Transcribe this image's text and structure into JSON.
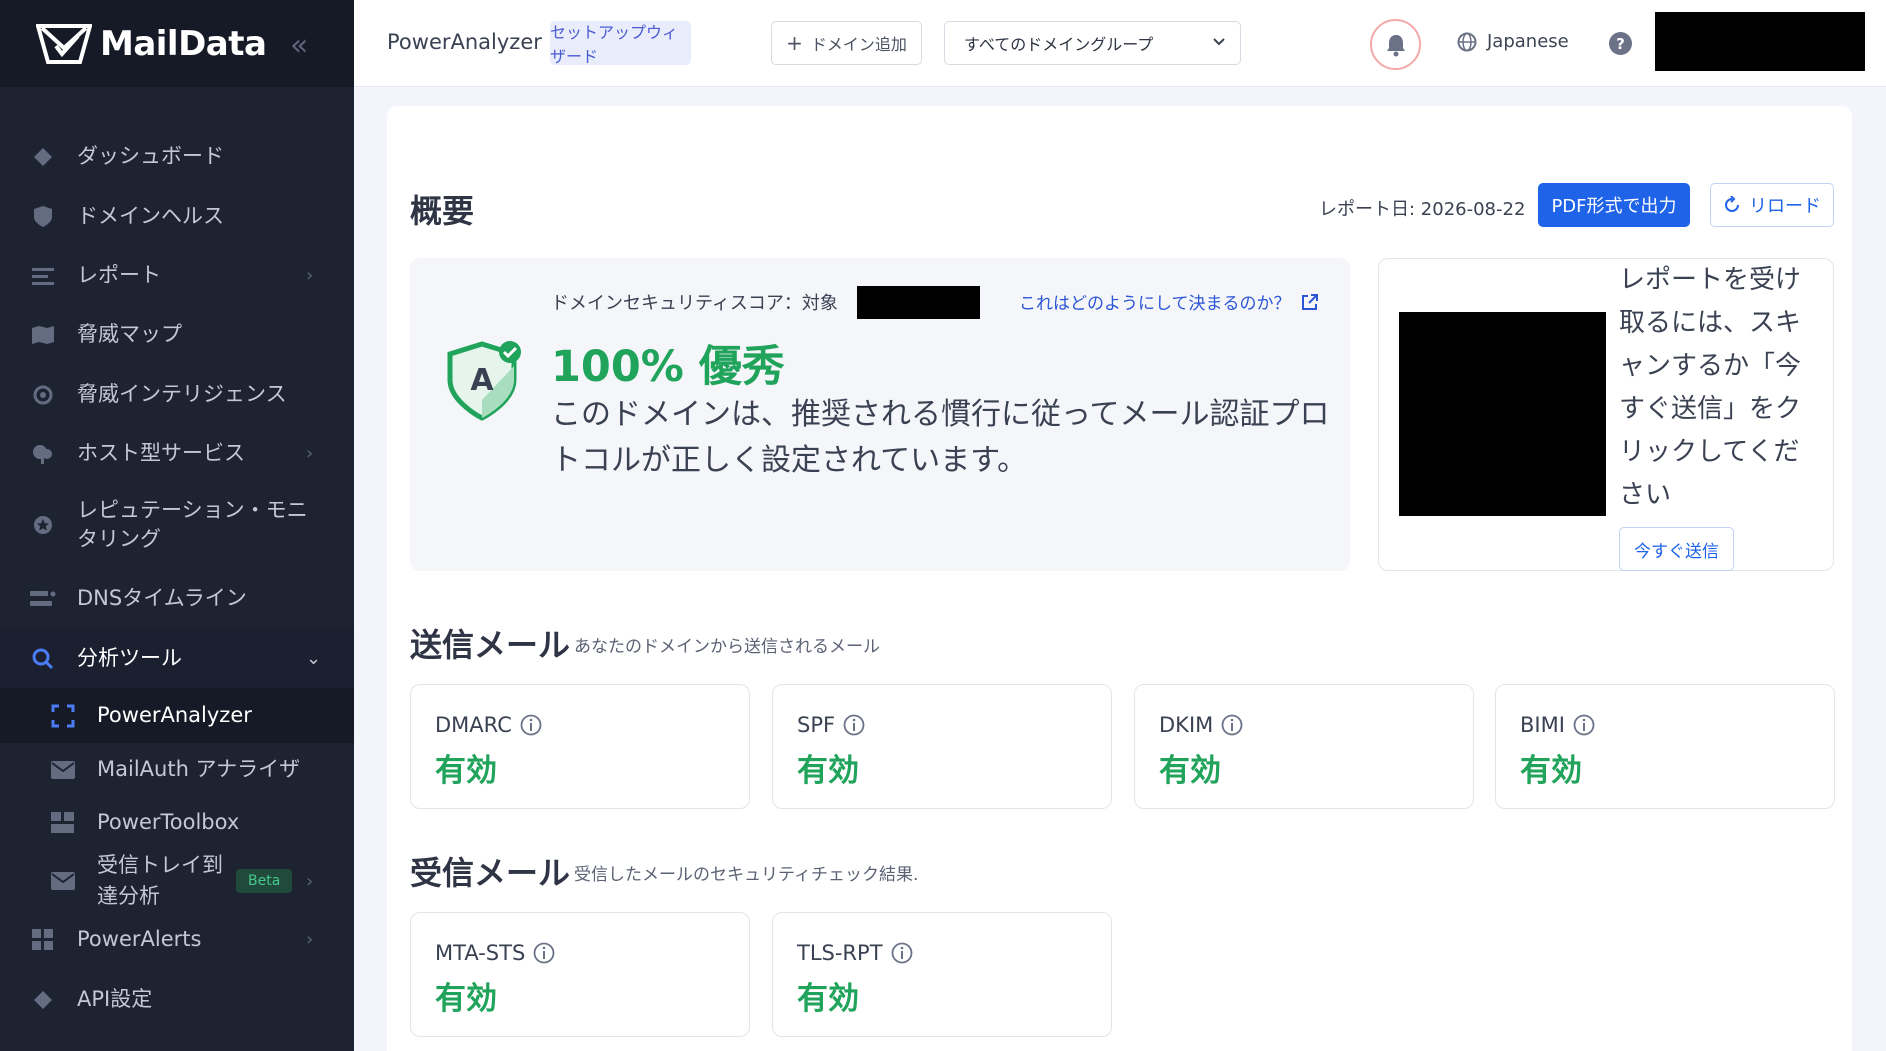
{
  "app": {
    "logo_text": "MailData",
    "collapse_icon": "«"
  },
  "sidebar": {
    "items": [
      {
        "label": "ダッシュボード",
        "icon": "diamond-icon"
      },
      {
        "label": "ドメインヘルス",
        "icon": "shield-check-icon"
      },
      {
        "label": "レポート",
        "icon": "lines-icon",
        "chevron": "›"
      },
      {
        "label": "脅威マップ",
        "icon": "map-icon"
      },
      {
        "label": "脅威インテリジェンス",
        "icon": "target-icon"
      },
      {
        "label": "ホスト型サービス",
        "icon": "cloud-icon",
        "chevron": "›"
      },
      {
        "label": "レピュテーション・モニタリング",
        "icon": "badge-icon"
      },
      {
        "label": "DNSタイムライン",
        "icon": "timeline-icon"
      },
      {
        "label": "分析ツール",
        "icon": "search-icon",
        "chevron": "⌄"
      },
      {
        "label": "PowerAnalyzer",
        "icon": "scan-icon"
      },
      {
        "label": "MailAuth アナライザ",
        "icon": "mail-icon"
      },
      {
        "label": "PowerToolbox",
        "icon": "toolbox-icon"
      },
      {
        "label": "受信トレイ到達分析",
        "icon": "envelope-icon",
        "badge": "Beta",
        "chevron": "›"
      },
      {
        "label": "PowerAlerts",
        "icon": "grid-icon",
        "chevron": "›"
      },
      {
        "label": "API設定",
        "icon": "diamond-icon"
      }
    ]
  },
  "header": {
    "brand": "PowerAnalyzer",
    "wizard": "セットアップウィザード",
    "add_domain": "ドメイン追加",
    "domain_group": "すべてのドメイングループ",
    "language": "Japanese",
    "help": "?"
  },
  "overview": {
    "title": "概要",
    "report_date": "レポート日: 2026-08-22",
    "pdf": "PDF形式で出力",
    "reload": "リロード"
  },
  "score": {
    "label": "ドメインセキュリティスコア：対象",
    "how_link": "これはどのようにして決まるのか？",
    "grade": "A",
    "value": "100% 優秀",
    "description": "このドメインは、推奨される慣行に従ってメール認証プロトコルが正しく設定されています。"
  },
  "send": {
    "text": "レポートを受け取るには、スキャンするか「今すぐ送信」をクリックしてください",
    "button": "今すぐ送信"
  },
  "outgoing": {
    "title": "送信メール",
    "subtitle": "あなたのドメインから送信されるメール",
    "cards": [
      {
        "name": "DMARC",
        "status": "有効"
      },
      {
        "name": "SPF",
        "status": "有効"
      },
      {
        "name": "DKIM",
        "status": "有効"
      },
      {
        "name": "BIMI",
        "status": "有効"
      }
    ]
  },
  "incoming": {
    "title": "受信メール",
    "subtitle": "受信したメールのセキュリティチェック結果.",
    "cards": [
      {
        "name": "MTA-STS",
        "status": "有効"
      },
      {
        "name": "TLS-RPT",
        "status": "有効"
      }
    ]
  },
  "colors": {
    "accent": "#1f63e8",
    "success": "#20a35a",
    "sidebar": "#1e2331"
  }
}
